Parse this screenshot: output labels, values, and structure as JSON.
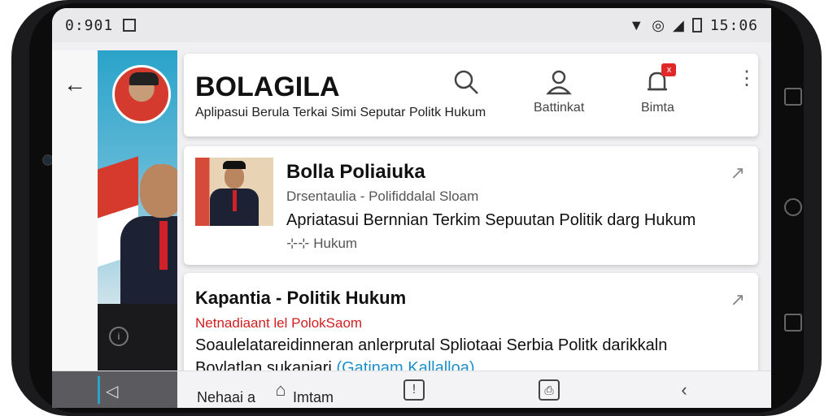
{
  "status_bar": {
    "time": "0:901",
    "clock": "15:06"
  },
  "header": {
    "app_title": "BOLAGILA",
    "subtitle": "Aplipasui Berula Terkai Simi Seputar Politk Hukum",
    "actions": [
      {
        "label": "",
        "icon": "search-icon"
      },
      {
        "label": "Battinkat",
        "icon": "user-icon"
      },
      {
        "label": "Bimta",
        "icon": "bell-icon",
        "badge": "x"
      }
    ]
  },
  "cards": [
    {
      "title": "Bolla Poliaiuka",
      "meta": "Drsentaulia - Polifiddalal Sloam",
      "description": "Apriatasui Bernnian Terkim Sepuutan Politik darg Hukum",
      "tag": "⊹⊹ Hukum"
    },
    {
      "title": "Kapantia - Politik Hukum",
      "meta": "Netnadiaant lel PolokSaom",
      "description": "Soaulelatareidinneran anlerprutal Spliotaai Serbia Politk darikkaln",
      "extra_text": "Bovlatlan sukaniari",
      "extra_link": "(Gatinam Kallalloa)"
    }
  ],
  "bottom_nav": {
    "label": "Nehaai a",
    "home_label": "Imtam"
  },
  "colors": {
    "accent_red": "#d21e1e",
    "link_blue": "#1d8fc9",
    "badge_red": "#e02828"
  }
}
